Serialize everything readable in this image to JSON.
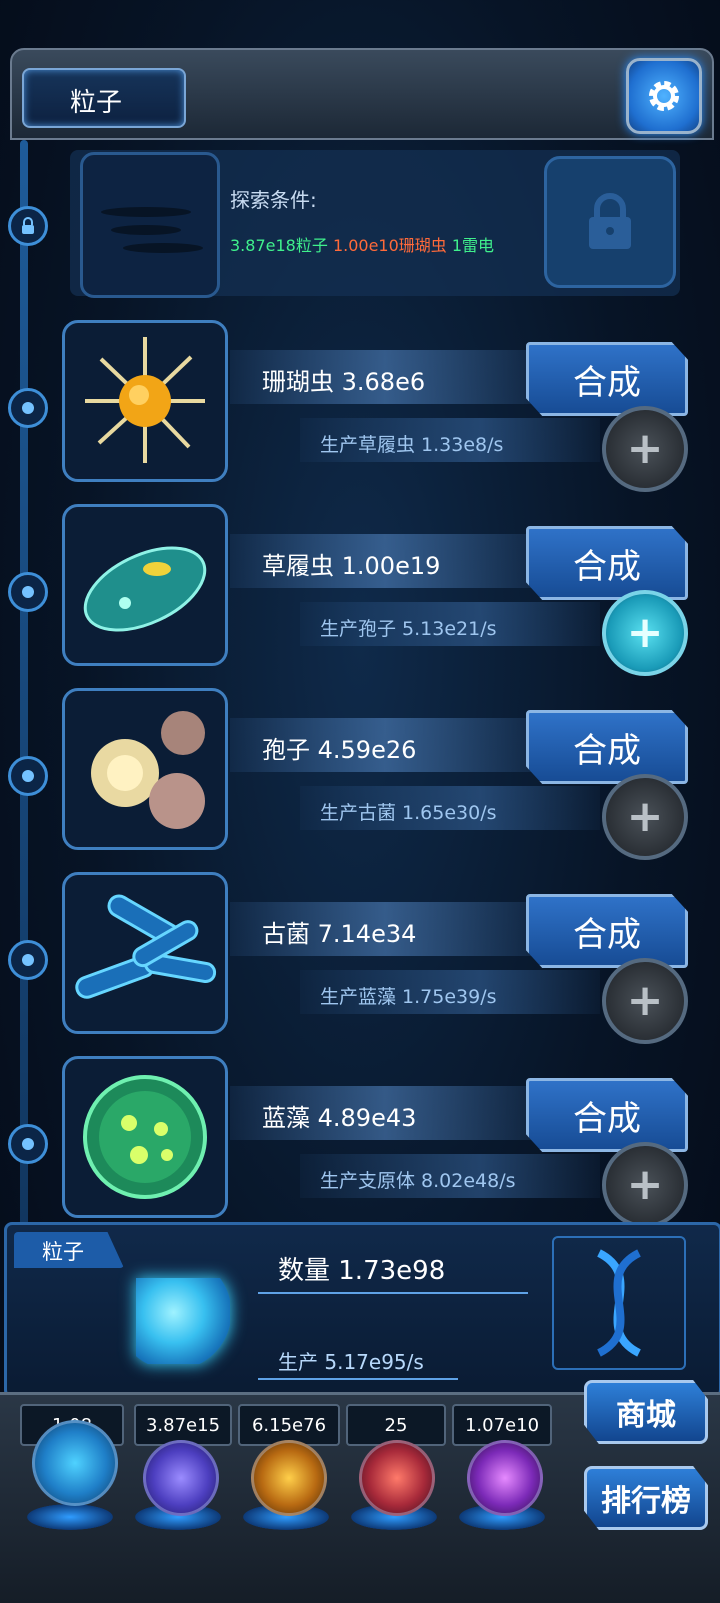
{
  "header": {
    "title": "粒子"
  },
  "explore": {
    "label": "探索条件:",
    "req_part1": "3.87e18粒子",
    "req_part2": "1.00e10珊瑚虫",
    "req_part3": "1雷电"
  },
  "items": [
    {
      "name": "珊瑚虫 3.68e6",
      "production": "生产草履虫 1.33e8/s",
      "button": "合成",
      "upgrade_active": false
    },
    {
      "name": "草履虫 1.00e19",
      "production": "生产孢子 5.13e21/s",
      "button": "合成",
      "upgrade_active": true
    },
    {
      "name": "孢子 4.59e26",
      "production": "生产古菌 1.65e30/s",
      "button": "合成",
      "upgrade_active": false
    },
    {
      "name": "古菌 7.14e34",
      "production": "生产蓝藻 1.75e39/s",
      "button": "合成",
      "upgrade_active": false
    },
    {
      "name": "蓝藻 4.89e43",
      "production": "生产支原体 8.02e48/s",
      "button": "合成",
      "upgrade_active": false
    }
  ],
  "particle": {
    "tag": "粒子",
    "count": "数量 1.73e98",
    "production": "生产 5.17e95/s"
  },
  "resources": [
    "1.08",
    "3.87e15",
    "6.15e76",
    "25",
    "1.07e10"
  ],
  "buttons": {
    "shop": "商城",
    "ranking": "排行榜"
  },
  "colors": {
    "accent": "#2f72c8",
    "req_green": "#3ff08c",
    "req_orange": "#ff6a3a"
  }
}
